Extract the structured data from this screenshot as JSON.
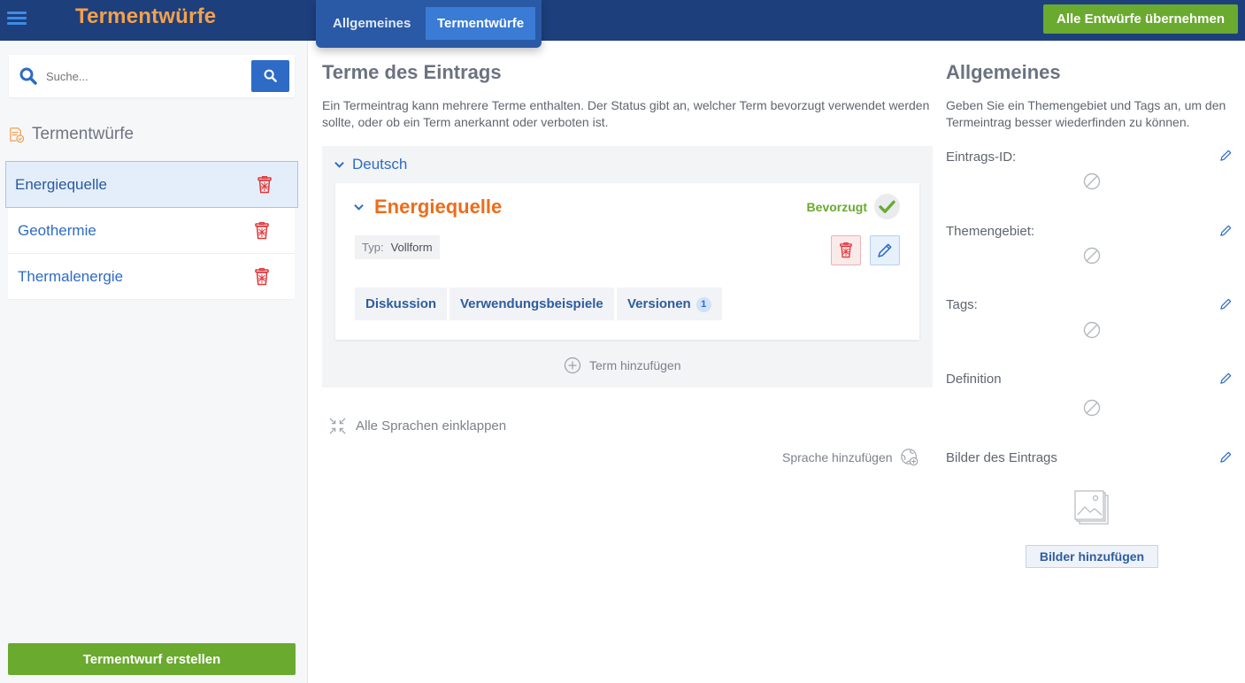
{
  "app": {
    "title": "Termentwürfe"
  },
  "topbar": {
    "tabs": [
      {
        "label": "Allgemeines",
        "active": false
      },
      {
        "label": "Termentwürfe",
        "active": true
      }
    ],
    "apply_all_label": "Alle Entwürfe übernehmen"
  },
  "sidebar": {
    "search_placeholder": "Suche...",
    "heading": "Termentwürfe",
    "drafts": [
      {
        "label": "Energiequelle",
        "selected": true
      },
      {
        "label": "Geothermie",
        "selected": false
      },
      {
        "label": "Thermalenergie",
        "selected": false
      }
    ],
    "create_label": "Termentwurf erstellen"
  },
  "main": {
    "title": "Terme des Eintrags",
    "description": "Ein Termeintrag kann mehrere Terme enthalten. Der Status gibt an, welcher Term bevorzugt verwendet werden sollte, oder ob ein Term anerkannt oder verboten ist.",
    "language": "Deutsch",
    "term": {
      "name": "Energiequelle",
      "status": "Bevorzugt",
      "type_key": "Typ:",
      "type_value": "Vollform",
      "tabs": [
        {
          "label": "Diskussion"
        },
        {
          "label": "Verwendungsbeispiele"
        },
        {
          "label": "Versionen",
          "badge": "1"
        }
      ]
    },
    "add_term_label": "Term hinzufügen",
    "collapse_all_label": "Alle Sprachen einklappen",
    "add_language_label": "Sprache hinzufügen"
  },
  "right": {
    "title": "Allgemeines",
    "description": "Geben Sie ein Themengebiet und Tags an, um den Termeintrag besser wiederfinden zu können.",
    "fields": [
      {
        "label": "Eintrags-ID:"
      },
      {
        "label": "Themengebiet:"
      },
      {
        "label": "Tags:"
      },
      {
        "label": "Definition"
      },
      {
        "label": "Bilder des Eintrags"
      }
    ],
    "add_images_label": "Bilder hinzufügen"
  },
  "colors": {
    "topbar": "#1d3f7c",
    "accent_orange": "#ee6c1a",
    "accent_blue": "#2e6bc6",
    "success_green": "#6aaa2f",
    "danger_red": "#e0383a"
  },
  "icons": [
    "hamburger-icon",
    "search-icon",
    "draft-list-icon",
    "trash-icon",
    "chevron-down-icon",
    "check-icon",
    "pencil-icon",
    "plus-circle-icon",
    "collapse-icon",
    "globe-add-icon",
    "empty-icon",
    "image-placeholder-icon"
  ]
}
